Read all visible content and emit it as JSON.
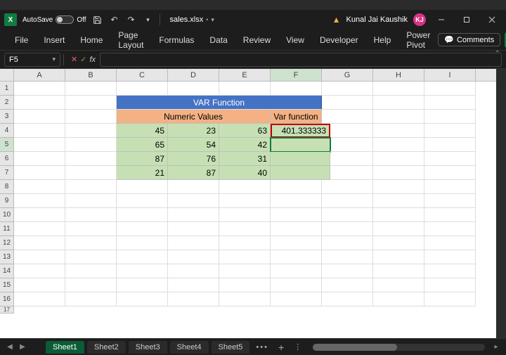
{
  "browser_menu": [
    "…",
    "…",
    "…",
    "…",
    "…",
    "…",
    "…",
    "…",
    "…"
  ],
  "titlebar": {
    "autosave_label": "AutoSave",
    "autosave_state": "Off",
    "filename": "sales.xlsx",
    "user_name": "Kunal Jai Kaushik",
    "user_initials": "KJ"
  },
  "ribbon": {
    "tabs": [
      "File",
      "Insert",
      "Home",
      "Page Layout",
      "Formulas",
      "Data",
      "Review",
      "View",
      "Developer",
      "Help",
      "Power Pivot"
    ],
    "comments_label": "Comments"
  },
  "formula_bar": {
    "name_box": "F5",
    "formula": ""
  },
  "grid": {
    "columns": [
      "A",
      "B",
      "C",
      "D",
      "E",
      "F",
      "G",
      "H",
      "I"
    ],
    "title_row": {
      "text": "VAR Function",
      "span_start": "C",
      "span_end": "F"
    },
    "header_row": {
      "numeric_values_label": "Numeric Values",
      "var_function_label": "Var function"
    },
    "data_rows": [
      {
        "c": "45",
        "d": "23",
        "e": "63",
        "f": "401.333333"
      },
      {
        "c": "65",
        "d": "54",
        "e": "42",
        "f": ""
      },
      {
        "c": "87",
        "d": "76",
        "e": "31",
        "f": ""
      },
      {
        "c": "21",
        "d": "87",
        "e": "40",
        "f": ""
      }
    ],
    "active_cell": "F5"
  },
  "sheets": {
    "tabs": [
      "Sheet1",
      "Sheet2",
      "Sheet3",
      "Sheet4",
      "Sheet5"
    ],
    "active": "Sheet1"
  }
}
